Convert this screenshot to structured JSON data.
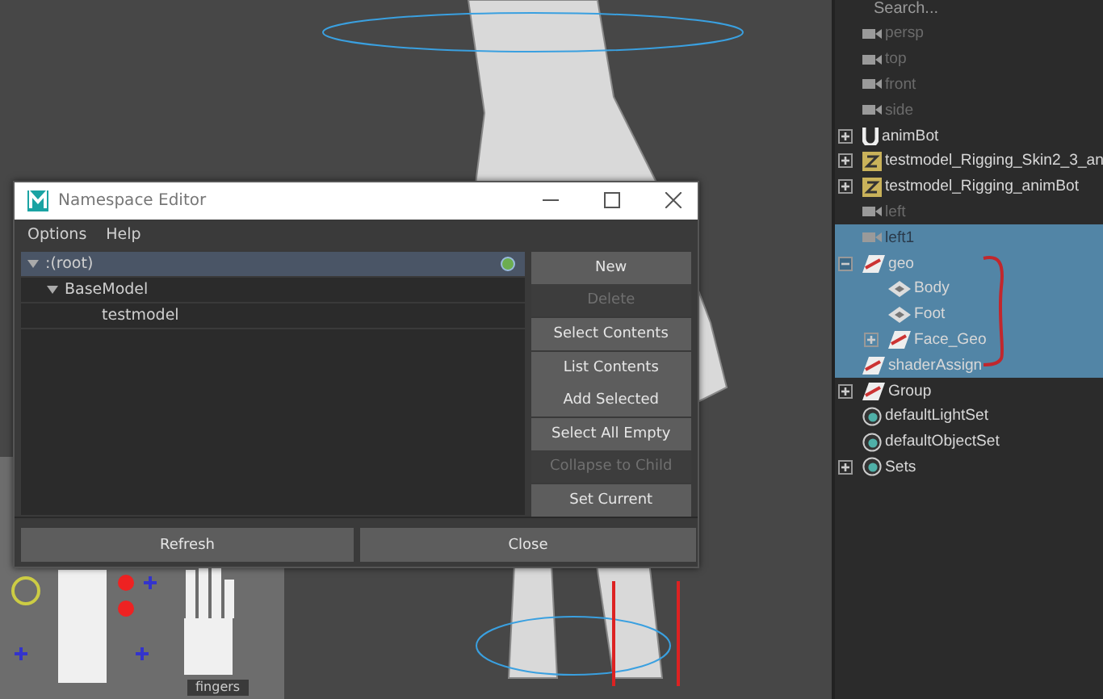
{
  "character_panel": {
    "tab_label": "fingers"
  },
  "outliner": {
    "search": {
      "placeholder": "Search..."
    },
    "items": [
      {
        "label": "persp",
        "kind": "camera",
        "dimmed": true,
        "selected": false,
        "expandable": false
      },
      {
        "label": "top",
        "kind": "camera",
        "dimmed": true,
        "selected": false,
        "expandable": false
      },
      {
        "label": "front",
        "kind": "camera",
        "dimmed": true,
        "selected": false,
        "expandable": false
      },
      {
        "label": "side",
        "kind": "camera",
        "dimmed": true,
        "selected": false,
        "expandable": false
      },
      {
        "label": "animBot",
        "kind": "joint",
        "dimmed": false,
        "selected": false,
        "expandable": true,
        "expanded": false
      },
      {
        "label": "testmodel_Rigging_Skin2_3_an",
        "kind": "reference",
        "dimmed": false,
        "selected": false,
        "expandable": true,
        "expanded": false
      },
      {
        "label": "testmodel_Rigging_animBot",
        "kind": "reference",
        "dimmed": false,
        "selected": false,
        "expandable": true,
        "expanded": false
      },
      {
        "label": "left",
        "kind": "camera",
        "dimmed": true,
        "selected": false,
        "expandable": false
      },
      {
        "label": "left1",
        "kind": "camera",
        "dimmed": true,
        "selected": true,
        "expandable": false
      },
      {
        "label": "geo",
        "kind": "transform",
        "dimmed": false,
        "selected": true,
        "expandable": true,
        "expanded": true,
        "children": [
          {
            "label": "Body",
            "kind": "shape",
            "dimmed": false,
            "selected": true,
            "expandable": false
          },
          {
            "label": "Foot",
            "kind": "shape",
            "dimmed": false,
            "selected": true,
            "expandable": false
          },
          {
            "label": "Face_Geo",
            "kind": "transform",
            "dimmed": false,
            "selected": true,
            "expandable": true,
            "expanded": false
          }
        ]
      },
      {
        "label": "shaderAssign",
        "kind": "transform",
        "dimmed": false,
        "selected": true,
        "expandable": false
      },
      {
        "label": "Group",
        "kind": "transform",
        "dimmed": false,
        "selected": false,
        "expandable": true,
        "expanded": false
      },
      {
        "label": "defaultLightSet",
        "kind": "set",
        "dimmed": false,
        "selected": false,
        "expandable": false
      },
      {
        "label": "defaultObjectSet",
        "kind": "set",
        "dimmed": false,
        "selected": false,
        "expandable": false
      },
      {
        "label": "Sets",
        "kind": "set",
        "dimmed": false,
        "selected": false,
        "expandable": true,
        "expanded": false
      }
    ]
  },
  "dialog": {
    "title": "Namespace Editor",
    "menu": [
      "Options",
      "Help"
    ],
    "tree": [
      {
        "label": ":(root)",
        "selected": true,
        "current": true,
        "expanded": true,
        "children": [
          {
            "label": "BaseModel",
            "selected": false,
            "expanded": true,
            "children": [
              {
                "label": "testmodel",
                "selected": false
              }
            ]
          }
        ]
      }
    ],
    "buttons": [
      {
        "label": "New",
        "disabled": false
      },
      {
        "label": "Delete",
        "disabled": true
      },
      {
        "label": "Select Contents",
        "disabled": false
      },
      {
        "label": "List Contents",
        "disabled": false
      },
      {
        "label": "Add Selected",
        "disabled": false
      },
      {
        "label": "Select All Empty",
        "disabled": false
      },
      {
        "label": "Collapse to Child",
        "disabled": true
      },
      {
        "label": "Set Current",
        "disabled": false
      }
    ],
    "footer_buttons": [
      "Refresh",
      "Close"
    ]
  }
}
